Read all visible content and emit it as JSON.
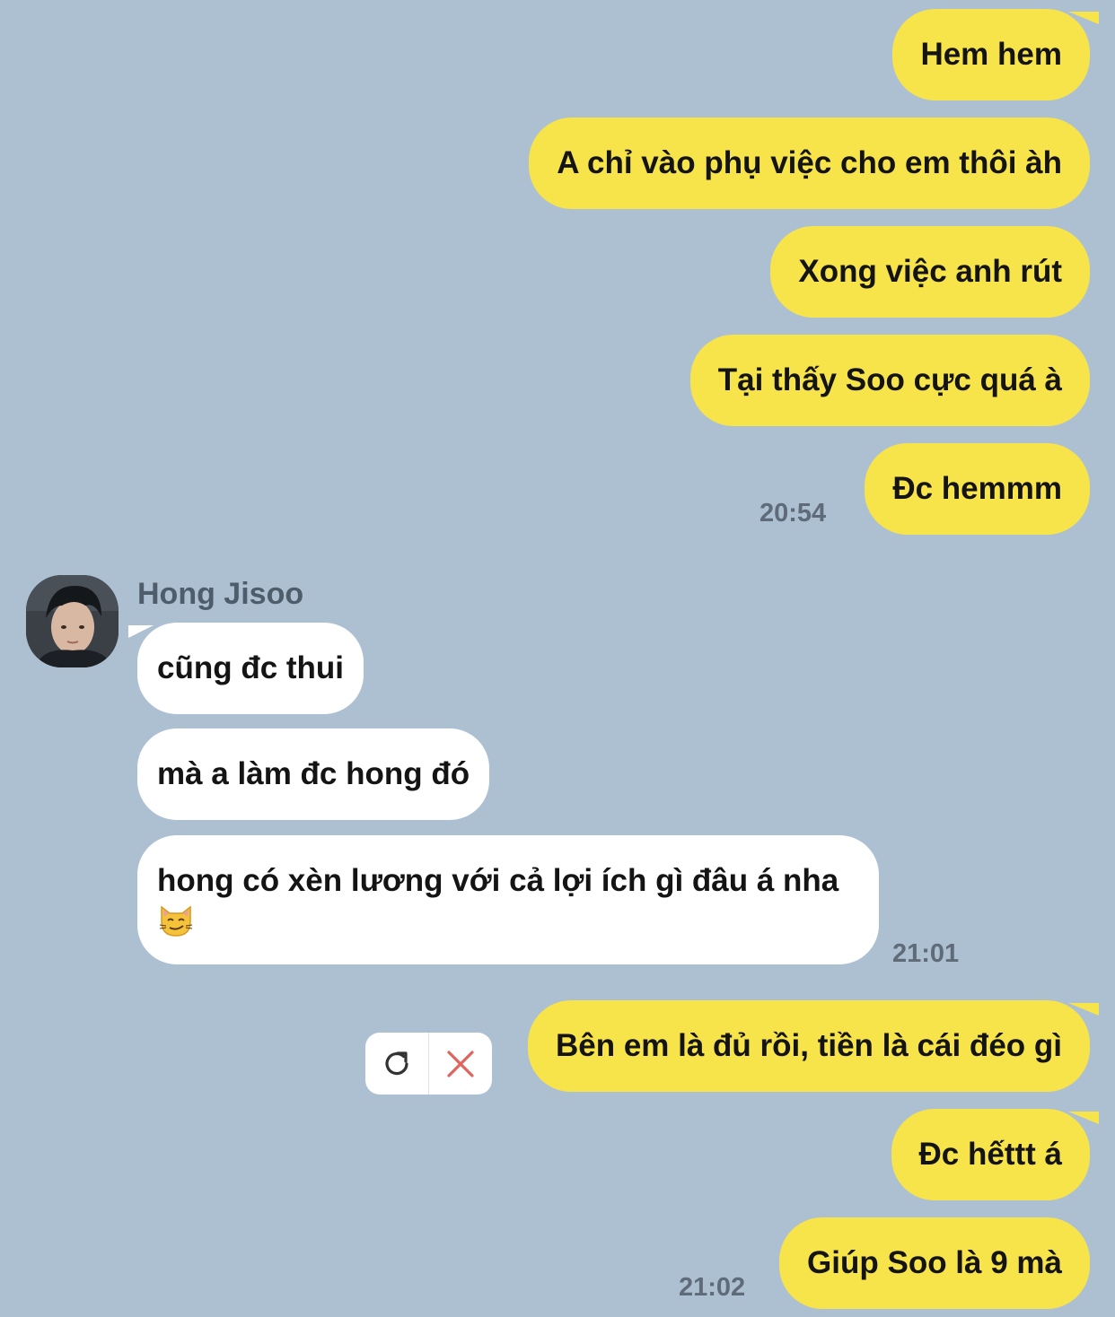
{
  "messages": {
    "outgoing_group_1": [
      "Hem hem",
      "A chỉ vào phụ việc cho em thôi àh",
      "Xong việc anh rút",
      "Tại thấy Soo cực quá à",
      "Đc hemmm"
    ],
    "time_1": "20:54",
    "incoming": {
      "sender_name": "Hong Jisoo",
      "bubbles": [
        "cũng đc thui",
        "mà a làm đc hong đó",
        "hong có xèn lương với cả lợi ích gì đâu á nha"
      ],
      "emoji_icon": "smirking-cat-icon",
      "time": "21:01"
    },
    "outgoing_group_2": [
      "Bên em là đủ rồi, tiền là cái đéo gì",
      "Đc hếttt á",
      "Giúp Soo là 9 mà"
    ],
    "time_2": "21:02"
  },
  "failed_send_actions": {
    "retry_icon": "retry-icon",
    "delete_icon": "delete-x-icon"
  },
  "colors": {
    "background": "#adc0d2",
    "outgoing_bubble": "#f7e34a",
    "incoming_bubble": "#ffffff",
    "delete_red": "#e0645e"
  }
}
